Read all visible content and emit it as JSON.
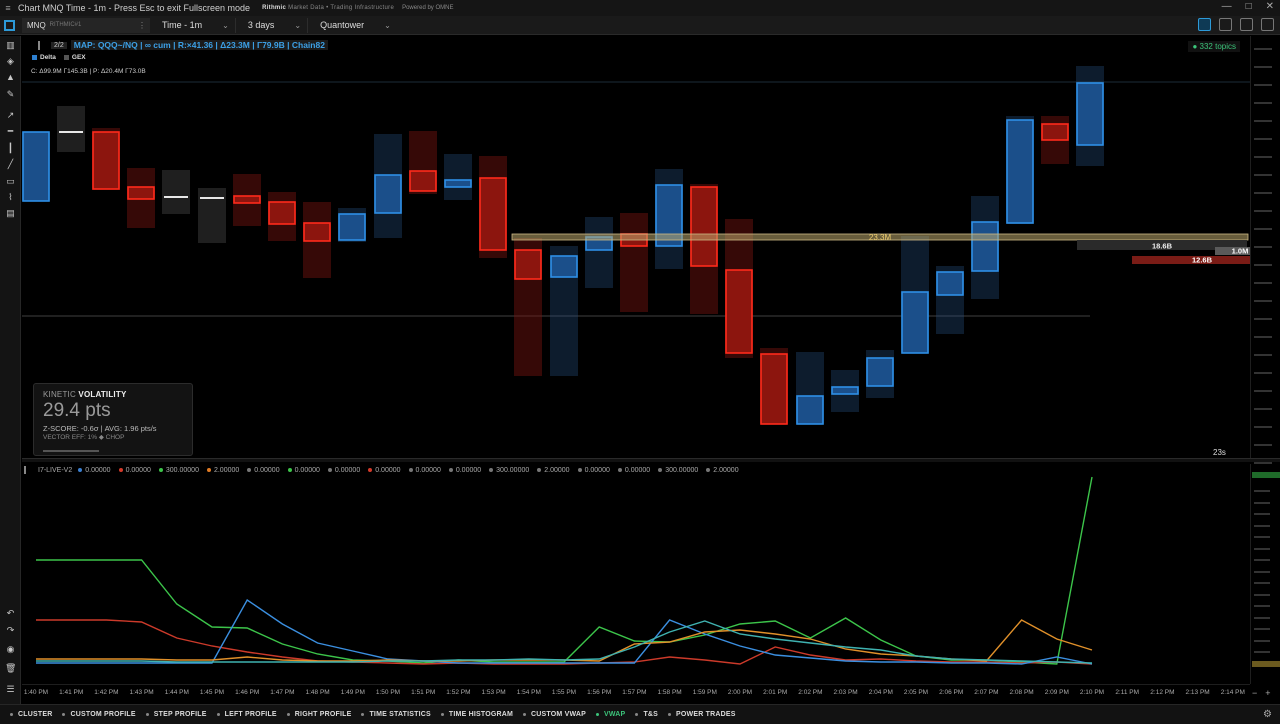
{
  "window": {
    "title": "Chart MNQ Time - 1m - Press Esc to exit Fullscreen mode",
    "rithmic_label": "Rithmic",
    "rithmic_tagline": "Market Data • Trading Infrastructure",
    "powered": "Powered by OMNE"
  },
  "toolbar": {
    "symbol": "MNQ",
    "exchange": "RITHMIC#1",
    "timeframe": "Time - 1m",
    "range": "3 days",
    "style": "Quantower"
  },
  "overlay": {
    "pager": "2/2",
    "map_title": "MAP: QQQ~/NQ | ∞ cum | R:×41.36 | Δ23.3M | Γ79.9B | Chain82",
    "legend": [
      {
        "label": "Delta",
        "color": "#2d7fd0"
      },
      {
        "label": "GEX",
        "color": "#555555"
      }
    ],
    "cp_line": "C: Δ99.9M Γ145.3B  |  P: Δ20.4M Γ73.0B",
    "topics": "● 332 topics",
    "zone_label": "23.3M",
    "level_labels": [
      {
        "text": "18.6B"
      },
      {
        "text": "1.0M"
      },
      {
        "text": "12.6B"
      }
    ],
    "countdown": "23s"
  },
  "kinetic": {
    "heading_prefix": "KINETIC",
    "heading_bold": "VOLATILITY",
    "value": "29.4 pts",
    "zscore": "Z-SCORE: -0.6σ  |  AVG: 1.96 pts/s",
    "vector": "VECTOR EFF: 1% ◆ CHOP"
  },
  "indicator": {
    "name": "I7-LIVE-V2",
    "values": [
      {
        "text": "0.00000",
        "color": "#3b7fd0"
      },
      {
        "text": "0.00000",
        "color": "#d43a2a"
      },
      {
        "text": "300.00000",
        "color": "#3cc44a"
      },
      {
        "text": "2.00000",
        "color": "#e07b24"
      },
      {
        "text": "0.00000",
        "color": "#777777"
      },
      {
        "text": "0.00000",
        "color": "#3cc44a"
      },
      {
        "text": "0.00000",
        "color": "#777777"
      },
      {
        "text": "0.00000",
        "color": "#d43a2a"
      },
      {
        "text": "0.00000",
        "color": "#777777"
      },
      {
        "text": "0.00000",
        "color": "#777777"
      },
      {
        "text": "300.00000",
        "color": "#777777"
      },
      {
        "text": "2.00000",
        "color": "#777777"
      },
      {
        "text": "0.00000",
        "color": "#777777"
      },
      {
        "text": "0.00000",
        "color": "#777777"
      },
      {
        "text": "300.00000",
        "color": "#777777"
      },
      {
        "text": "2.00000",
        "color": "#777777"
      }
    ]
  },
  "time_labels": [
    "1:40 PM",
    "1:41 PM",
    "1:42 PM",
    "1:43 PM",
    "1:44 PM",
    "1:45 PM",
    "1:46 PM",
    "1:47 PM",
    "1:48 PM",
    "1:49 PM",
    "1:50 PM",
    "1:51 PM",
    "1:52 PM",
    "1:53 PM",
    "1:54 PM",
    "1:55 PM",
    "1:56 PM",
    "1:57 PM",
    "1:58 PM",
    "1:59 PM",
    "2:00 PM",
    "2:01 PM",
    "2:02 PM",
    "2:03 PM",
    "2:04 PM",
    "2:05 PM",
    "2:06 PM",
    "2:07 PM",
    "2:08 PM",
    "2:09 PM",
    "2:10 PM",
    "2:11 PM",
    "2:12 PM",
    "2:13 PM",
    "2:14 PM"
  ],
  "bottom_tabs": [
    {
      "label": "CLUSTER",
      "active": false
    },
    {
      "label": "CUSTOM PROFILE",
      "active": false
    },
    {
      "label": "STEP PROFILE",
      "active": false
    },
    {
      "label": "LEFT PROFILE",
      "active": false
    },
    {
      "label": "RIGHT PROFILE",
      "active": false
    },
    {
      "label": "TIME STATISTICS",
      "active": false
    },
    {
      "label": "TIME HISTOGRAM",
      "active": false
    },
    {
      "label": "CUSTOM VWAP",
      "active": false
    },
    {
      "label": "VWAP",
      "active": true
    },
    {
      "label": "T&S",
      "active": false
    },
    {
      "label": "POWER TRADES",
      "active": false
    }
  ],
  "colors": {
    "up": "#2d7fd0",
    "down": "#e0281e",
    "neutral": "#cfcfcf",
    "accent": "#2d9ad8"
  }
}
